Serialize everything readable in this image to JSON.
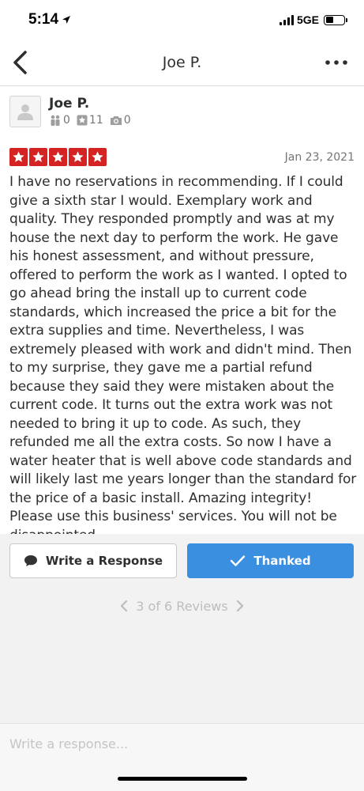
{
  "status_bar": {
    "time": "5:14",
    "network": "5GE"
  },
  "nav": {
    "title": "Joe P."
  },
  "reviewer": {
    "name": "Joe P.",
    "friends": "0",
    "reviews": "11",
    "photos": "0"
  },
  "review": {
    "rating": 5,
    "date": "Jan 23, 2021",
    "text": "I have no reservations in recommending. If I could give a sixth star I would. Exemplary work and quality. They responded promptly and was at my house the next day to perform the work. He gave his honest assessment, and without pressure, offered to perform the work as I wanted. I opted to go ahead bring the install up to current code standards, which increased the price a bit for the extra supplies and time. Nevertheless, I was extremely pleased with work and didn't mind. Then to my surprise, they gave me a partial refund because they said they were mistaken about the current code. It turns out the extra work was not needed to bring it up to code. As such, they refunded me all the extra costs. So now I have a water heater that is well above code standards and will likely last me years longer than the standard for the price of a basic install. Amazing integrity! Please use this business' services. You will not be disappointed."
  },
  "actions": {
    "write_response_label": "Write a Response",
    "thanked_label": "Thanked"
  },
  "pager": {
    "label": "3 of 6 Reviews"
  },
  "compose": {
    "placeholder": "Write a response..."
  },
  "colors": {
    "star_red": "#d32323",
    "accent_blue": "#3b8fe0"
  }
}
